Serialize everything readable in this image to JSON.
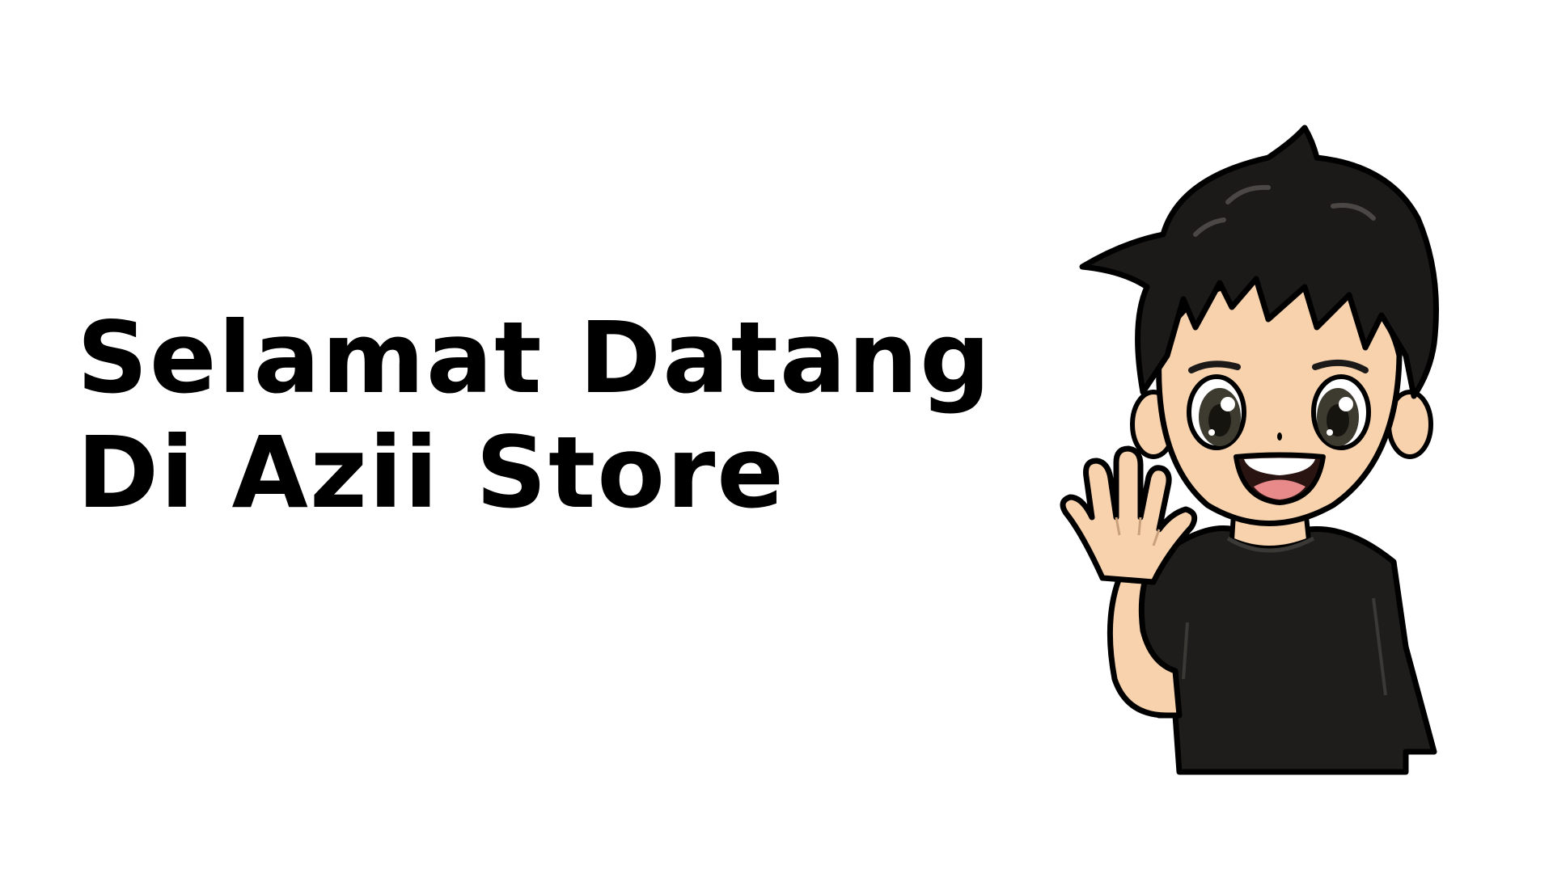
{
  "welcome": {
    "line1": "Selamat Datang",
    "line2": "Di Azii Store"
  },
  "mascot": {
    "icon": "waving-boy-icon"
  },
  "colors": {
    "background": "#ffffff",
    "text": "#000000",
    "hair": "#1c1a19",
    "skin": "#f7d2ac",
    "shirt": "#1e1d1b",
    "eyes": "#3d3b30",
    "mouth": "#e8898a",
    "outline": "#000000"
  }
}
